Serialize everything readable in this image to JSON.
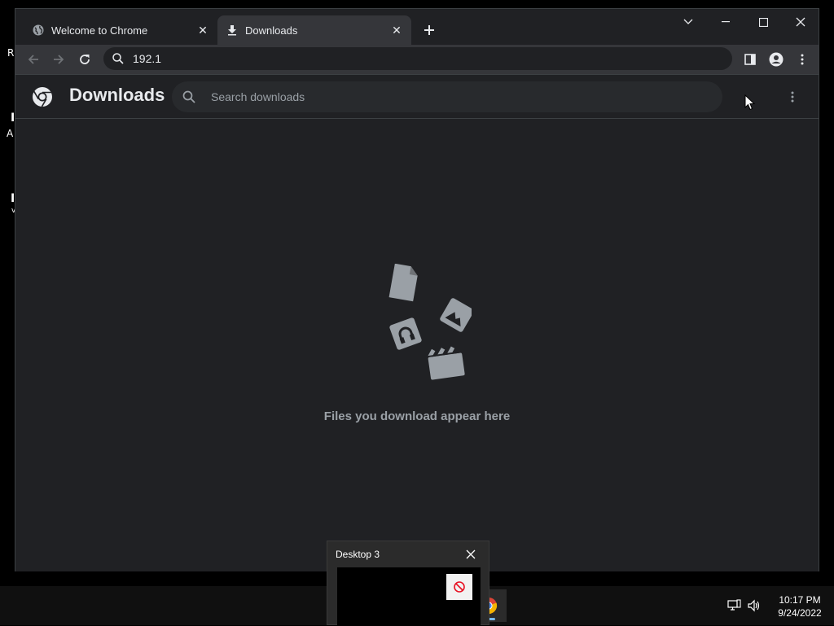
{
  "browser": {
    "tabs": [
      {
        "label": "Welcome to Chrome",
        "icon": "globe-icon",
        "active": false
      },
      {
        "label": "Downloads",
        "icon": "download-icon",
        "active": true
      }
    ],
    "address": "192.1"
  },
  "downloads_page": {
    "title": "Downloads",
    "search_placeholder": "Search downloads",
    "empty_message": "Files you download appear here"
  },
  "desktop": {
    "fragments": [
      "R",
      "I",
      "A",
      "I",
      "v"
    ]
  },
  "taskbar": {
    "time": "10:17 PM",
    "date": "9/24/2022",
    "desktop_preview": {
      "label": "Desktop 3"
    }
  },
  "colors": {
    "window_bg": "#202124",
    "toolbar_bg": "#35363a",
    "text": "#e8eaed",
    "muted": "#9aa0a6",
    "accent": "#76b9ed"
  }
}
